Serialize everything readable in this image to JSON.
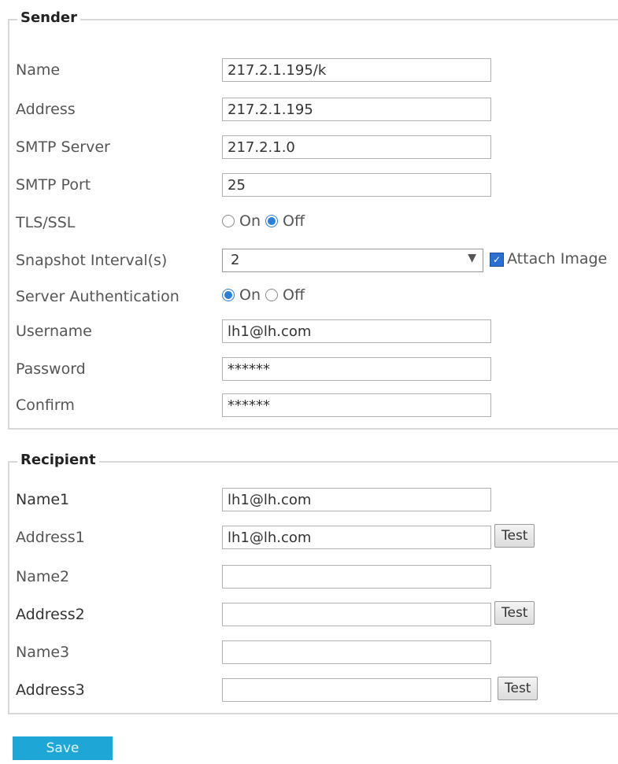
{
  "sender": {
    "title": "Sender",
    "name_label": "Name",
    "name_value": "217.2.1.195/k",
    "address_label": "Address",
    "address_value": "217.2.1.195",
    "smtp_server_label": "SMTP Server",
    "smtp_server_value": "217.2.1.0",
    "smtp_port_label": "SMTP Port",
    "smtp_port_value": "25",
    "tls_label": "TLS/SSL",
    "tls_on": "On",
    "tls_off": "Off",
    "snapshot_label": "Snapshot Interval(s)",
    "snapshot_value": "2",
    "attach_image_label": "Attach Image",
    "auth_label": "Server Authentication",
    "auth_on": "On",
    "auth_off": "Off",
    "username_label": "Username",
    "username_value": "lh1@lh.com",
    "password_label": "Password",
    "password_value": "******",
    "confirm_label": "Confirm",
    "confirm_value": "******"
  },
  "recipient": {
    "title": "Recipient",
    "name1_label": "Name1",
    "name1_value": "lh1@lh.com",
    "address1_label": "Address1",
    "address1_value": "lh1@lh.com",
    "name2_label": "Name2",
    "name2_value": "",
    "address2_label": "Address2",
    "address2_value": "",
    "name3_label": "Name3",
    "name3_value": "",
    "address3_label": "Address3",
    "address3_value": "",
    "test_label": "Test"
  },
  "save_label": "Save"
}
